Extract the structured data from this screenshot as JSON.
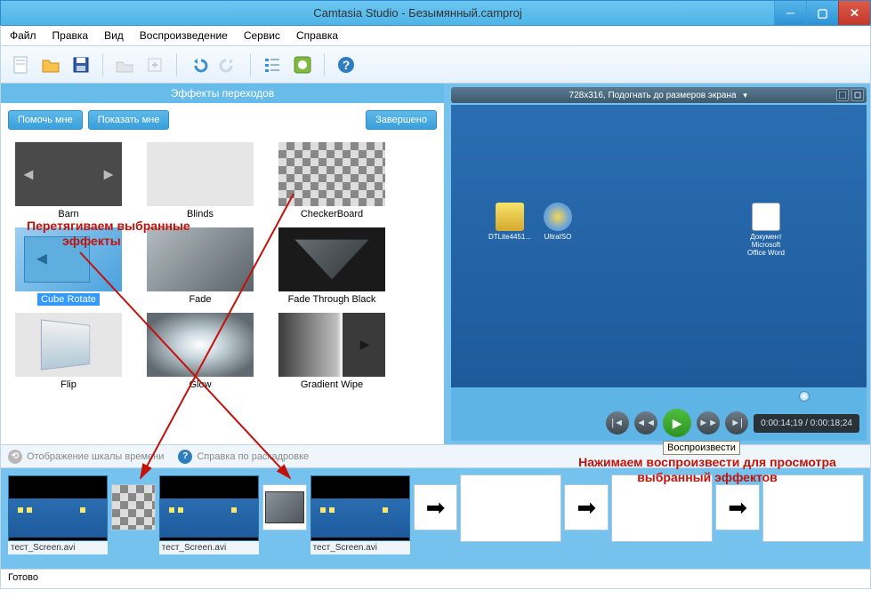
{
  "window": {
    "title": "Camtasia Studio - Безымянный.camproj"
  },
  "menu": [
    "Файл",
    "Правка",
    "Вид",
    "Воспроизведение",
    "Сервис",
    "Справка"
  ],
  "panel": {
    "header": "Эффекты переходов",
    "btn_help": "Помочь мне",
    "btn_show": "Показать мне",
    "btn_done": "Завершено"
  },
  "effects": [
    {
      "label": "Barn"
    },
    {
      "label": "Blinds"
    },
    {
      "label": "CheckerBoard"
    },
    {
      "label": "Cube Rotate",
      "selected": true
    },
    {
      "label": "Fade"
    },
    {
      "label": "Fade Through Black"
    },
    {
      "label": "Flip"
    },
    {
      "label": "Glow"
    },
    {
      "label": "Gradient Wipe"
    }
  ],
  "preview": {
    "size_label": "728x316, Подогнать до размеров экрана",
    "timecode": "0:00:14;19 / 0:00:18;24",
    "tooltip": "Воспроизвести",
    "desktop_icons": [
      "DTLite4451...",
      "UltraISO",
      "Документ Microsoft Office Word"
    ]
  },
  "timeline_opts": {
    "opt1": "Отображение шкалы времени",
    "opt2": "Справка по раскадровке"
  },
  "clips": [
    {
      "label": "тест_Screen.avi"
    },
    {
      "label": "тест_Screen.avi"
    },
    {
      "label": "тест_Screen.avi"
    }
  ],
  "status": "Готово",
  "annotations": {
    "a1_l1": "Перетягиваем выбранные",
    "a1_l2": "эффекты",
    "a2_l1": "Нажимаем воспроизвести для просмотра",
    "a2_l2": "выбранный эффектов"
  }
}
